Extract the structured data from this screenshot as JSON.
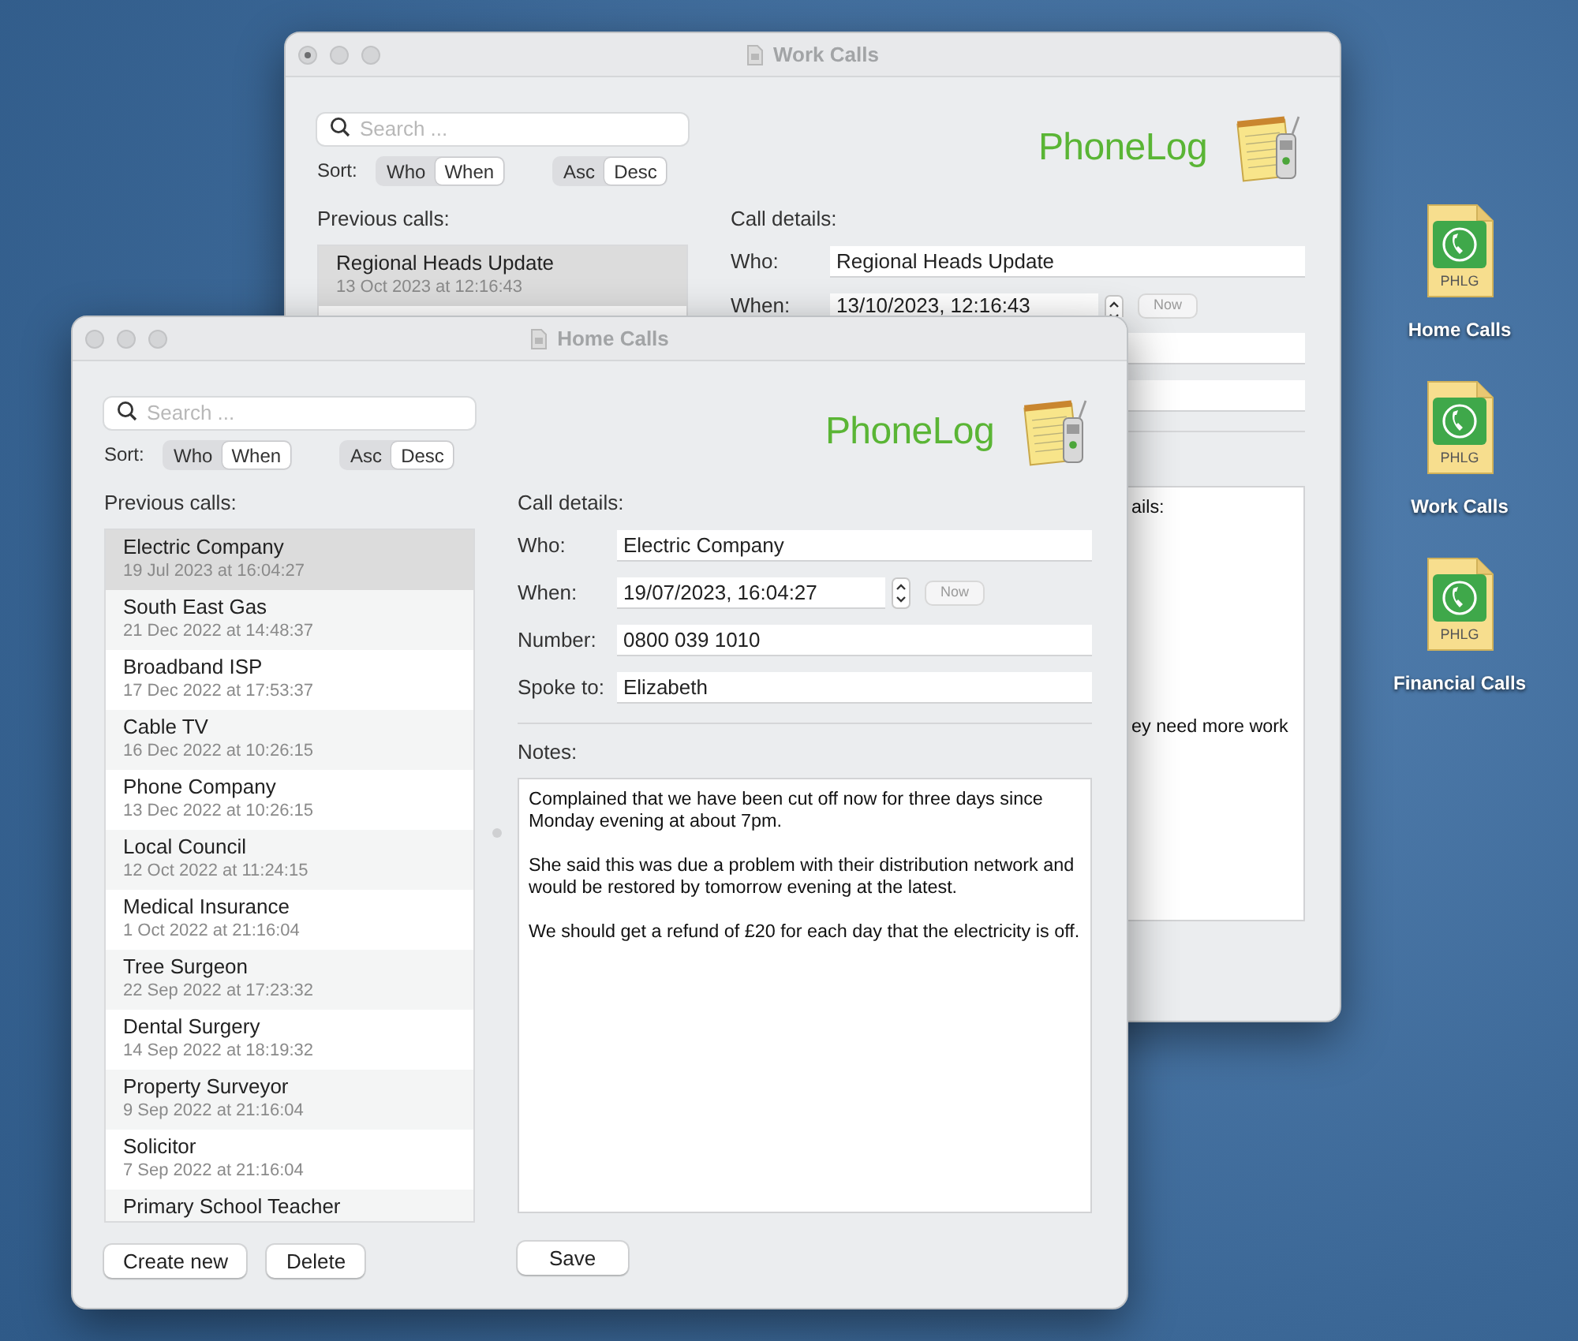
{
  "desktop_icons": [
    {
      "label": "Home Calls",
      "badge": "PHLG"
    },
    {
      "label": "Work Calls",
      "badge": "PHLG"
    },
    {
      "label": "Financial Calls",
      "badge": "PHLG"
    }
  ],
  "windows": [
    {
      "title": "Work Calls",
      "edited": true,
      "search": {
        "placeholder": "Search ..."
      },
      "sort_label": "Sort:",
      "sort_field": [
        {
          "label": "Who",
          "selected": false
        },
        {
          "label": "When",
          "selected": true
        }
      ],
      "sort_order": [
        {
          "label": "Asc",
          "selected": false
        },
        {
          "label": "Desc",
          "selected": true
        }
      ],
      "logo": "PhoneLog",
      "list_heading": "Previous calls:",
      "calls": [
        {
          "name": "Regional Heads Update",
          "date": "13 Oct 2023 at 12:16:43",
          "selected": true
        }
      ],
      "details_heading": "Call details:",
      "fields": [
        {
          "kind": "text",
          "label": "Who:",
          "value": "Regional Heads Update"
        },
        {
          "kind": "datetime",
          "label": "When:",
          "value": "13/10/2023, 12:16:43",
          "button": "Now"
        },
        {
          "kind": "text"
        },
        {
          "kind": "text"
        }
      ],
      "notes_fragments": [
        "ails:",
        "ey need more work"
      ]
    },
    {
      "title": "Home Calls",
      "edited": false,
      "search": {
        "placeholder": "Search ..."
      },
      "sort_label": "Sort:",
      "sort_field": [
        {
          "label": "Who",
          "selected": false
        },
        {
          "label": "When",
          "selected": true
        }
      ],
      "sort_order": [
        {
          "label": "Asc",
          "selected": false
        },
        {
          "label": "Desc",
          "selected": true
        }
      ],
      "logo": "PhoneLog",
      "list_heading": "Previous calls:",
      "calls": [
        {
          "name": "Electric Company",
          "date": "19 Jul 2023 at 16:04:27",
          "selected": true
        },
        {
          "name": "South East Gas",
          "date": "21 Dec 2022 at 14:48:37",
          "selected": false
        },
        {
          "name": "Broadband ISP",
          "date": "17 Dec 2022 at 17:53:37",
          "selected": false
        },
        {
          "name": "Cable TV",
          "date": "16 Dec 2022 at 10:26:15",
          "selected": false
        },
        {
          "name": "Phone Company",
          "date": "13 Dec 2022 at 10:26:15",
          "selected": false
        },
        {
          "name": "Local Council",
          "date": "12 Oct 2022 at 11:24:15",
          "selected": false
        },
        {
          "name": "Medical Insurance",
          "date": "1 Oct 2022 at 21:16:04",
          "selected": false
        },
        {
          "name": "Tree Surgeon",
          "date": "22 Sep 2022 at 17:23:32",
          "selected": false
        },
        {
          "name": "Dental Surgery",
          "date": "14 Sep 2022 at 18:19:32",
          "selected": false
        },
        {
          "name": "Property Surveyor",
          "date": "9 Sep 2022 at 21:16:04",
          "selected": false
        },
        {
          "name": "Solicitor",
          "date": "7 Sep 2022 at 21:16:04",
          "selected": false
        },
        {
          "name": "Primary School Teacher",
          "selected": false
        }
      ],
      "buttons": [
        "Create new",
        "Delete"
      ],
      "details_heading": "Call details:",
      "fields": [
        {
          "kind": "text",
          "label": "Who:",
          "value": "Electric Company"
        },
        {
          "kind": "datetime",
          "label": "When:",
          "value": "19/07/2023, 16:04:27",
          "button": "Now"
        },
        {
          "kind": "text",
          "label": "Number:",
          "value": "0800 039 1010"
        },
        {
          "kind": "text",
          "label": "Spoke to:",
          "value": "Elizabeth"
        }
      ],
      "notes_label": "Notes:",
      "notes": [
        "Complained that we have been cut off now for three days since Monday evening at about 7pm.",
        "She said this was due a problem with their distribution network and would be restored by tomorrow evening at the latest.",
        "We should get a refund of £20 for each day that the electricity is off."
      ],
      "save_button": "Save"
    }
  ]
}
